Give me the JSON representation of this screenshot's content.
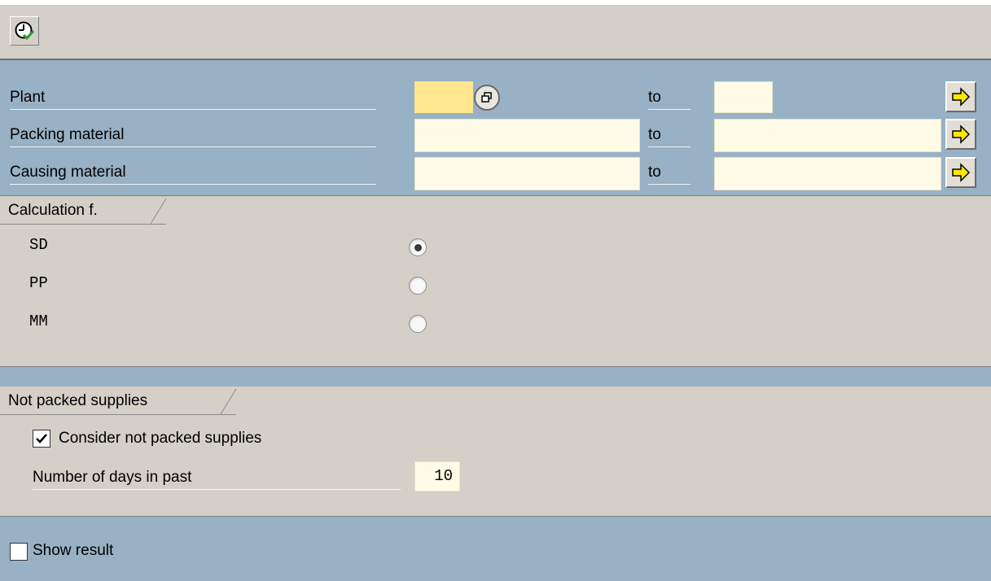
{
  "toolbar": {
    "execute_icon": "clock-execute-icon"
  },
  "selection": {
    "rows": [
      {
        "label": "Plant",
        "from_value": "",
        "to_label": "to",
        "to_value": ""
      },
      {
        "label": "Packing material",
        "from_value": "",
        "to_label": "to",
        "to_value": ""
      },
      {
        "label": "Causing material",
        "from_value": "",
        "to_label": "to",
        "to_value": ""
      }
    ]
  },
  "calculation": {
    "title": "Calculation f.",
    "options": [
      {
        "label": "SD",
        "selected": true
      },
      {
        "label": "PP",
        "selected": false
      },
      {
        "label": "MM",
        "selected": false
      }
    ]
  },
  "not_packed": {
    "title": "Not packed supplies",
    "consider_label": "Consider not packed supplies",
    "consider_checked": true,
    "days_label": "Number of days in past",
    "days_value": "10"
  },
  "result": {
    "show_label": "Show result",
    "checked": false
  },
  "colors": {
    "band": "#98b1c4",
    "panel": "#d4d0c8",
    "input": "#fffbe6",
    "required": "#ffe68f"
  }
}
